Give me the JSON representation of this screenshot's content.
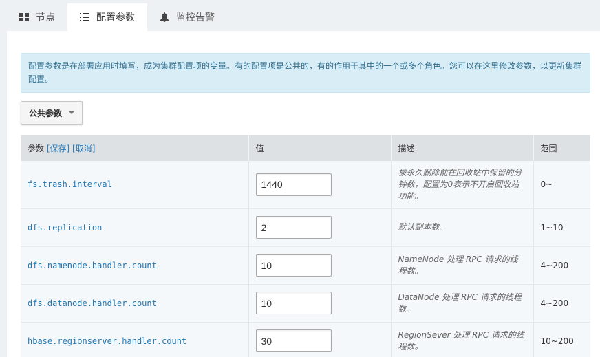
{
  "tabs": [
    {
      "label": "节点",
      "icon": "grid-icon"
    },
    {
      "label": "配置参数",
      "icon": "list-icon"
    },
    {
      "label": "监控告警",
      "icon": "bell-icon"
    }
  ],
  "notice": "配置参数是在部署应用时填写，成为集群配置项的变量。有的配置项是公共的，有的作用于其中的一个或多个角色。您可以在这里修改参数，以更新集群配置。",
  "dropdown": {
    "label": "公共参数"
  },
  "table": {
    "headers": {
      "param": "参数",
      "save": "[保存]",
      "cancel": "[取消]",
      "value": "值",
      "desc": "描述",
      "range": "范围"
    },
    "rows": [
      {
        "param": "fs.trash.interval",
        "value": "1440",
        "desc": "被永久删除前在回收站中保留的分钟数，配置为0表示不开启回收站功能。",
        "range": "0~"
      },
      {
        "param": "dfs.replication",
        "value": "2",
        "desc": "默认副本数。",
        "range": "1~10"
      },
      {
        "param": "dfs.namenode.handler.count",
        "value": "10",
        "desc": "NameNode 处理 RPC 请求的线程数。",
        "range": "4~200"
      },
      {
        "param": "dfs.datanode.handler.count",
        "value": "10",
        "desc": "DataNode 处理 RPC 请求的线程数。",
        "range": "4~200"
      },
      {
        "param": "hbase.regionserver.handler.count",
        "value": "30",
        "desc": "RegionSever 处理 RPC 请求的线程数。",
        "range": "10~200"
      }
    ]
  }
}
